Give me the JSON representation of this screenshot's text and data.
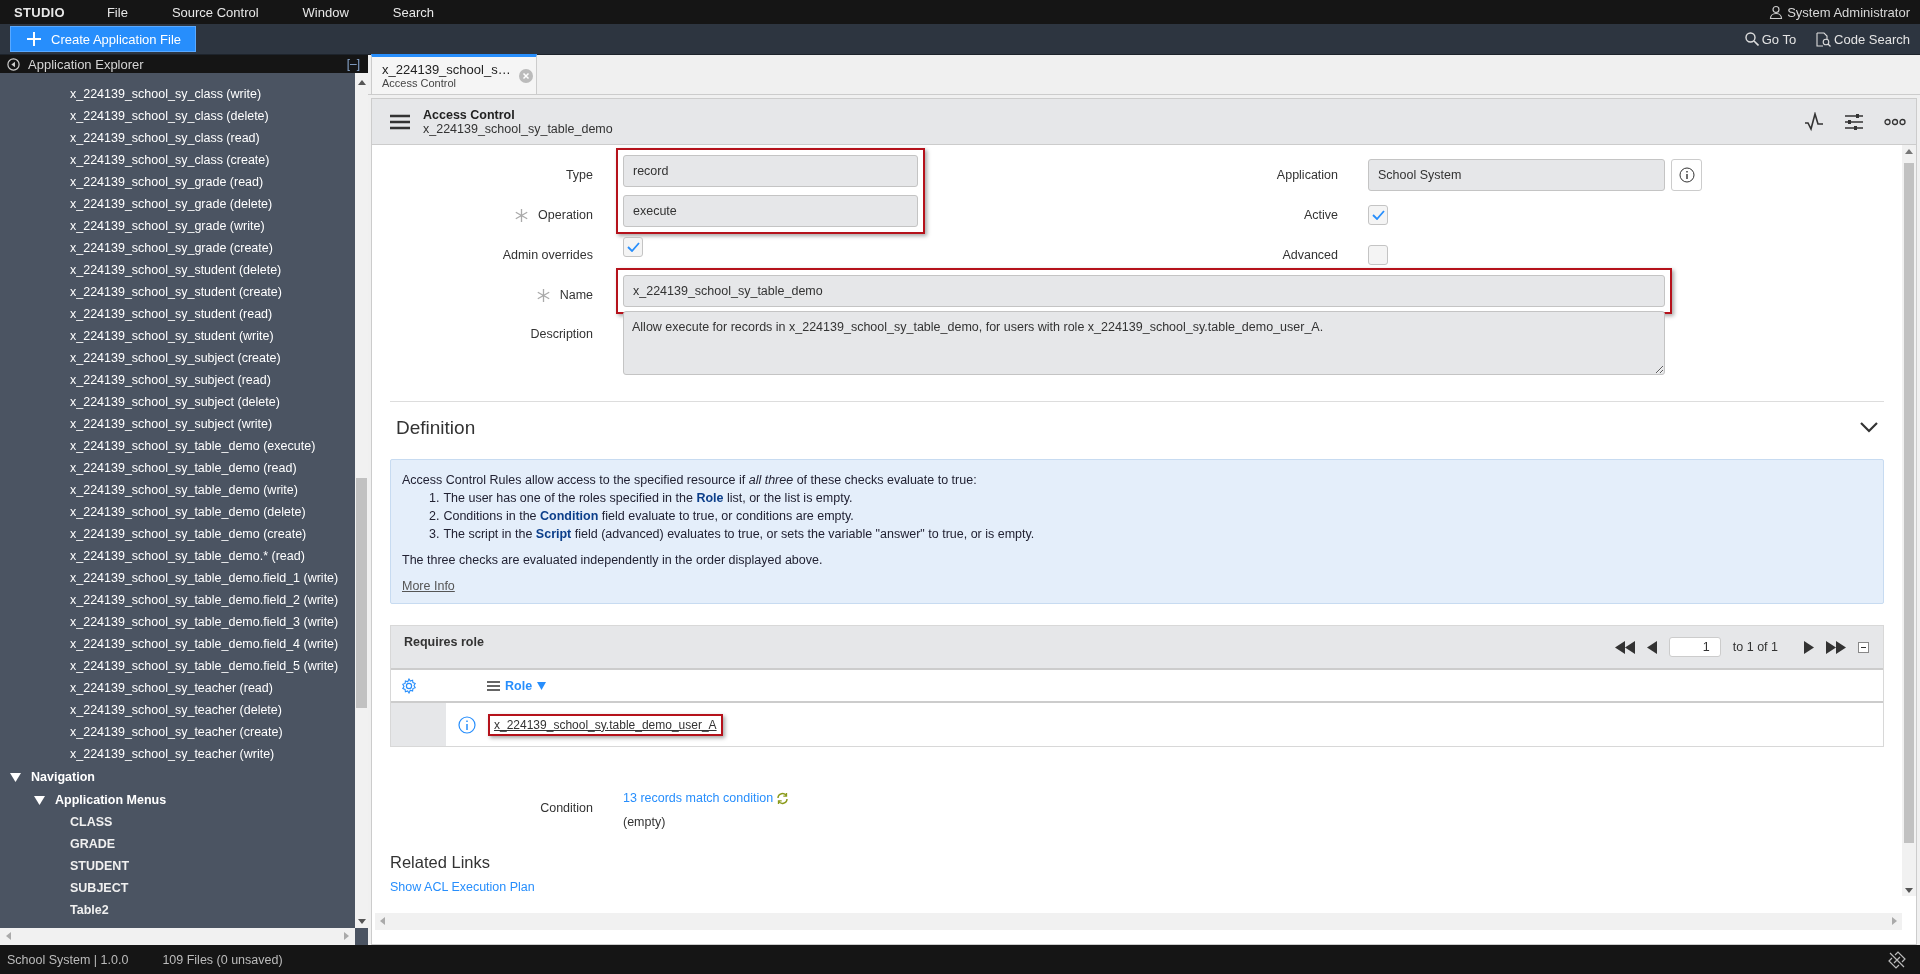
{
  "menubar": {
    "items": [
      "STUDIO",
      "File",
      "Source Control",
      "Window",
      "Search"
    ],
    "user": "System Administrator"
  },
  "toolbar": {
    "create_button": "Create Application File",
    "go_to": "Go To",
    "code_search": "Code Search"
  },
  "sidebar": {
    "title": "Application Explorer",
    "collapse": "[–]",
    "acl_items": [
      "x_224139_school_sy_class (write)",
      "x_224139_school_sy_class (delete)",
      "x_224139_school_sy_class (read)",
      "x_224139_school_sy_class (create)",
      "x_224139_school_sy_grade (read)",
      "x_224139_school_sy_grade (delete)",
      "x_224139_school_sy_grade (write)",
      "x_224139_school_sy_grade (create)",
      "x_224139_school_sy_student (delete)",
      "x_224139_school_sy_student (create)",
      "x_224139_school_sy_student (read)",
      "x_224139_school_sy_student (write)",
      "x_224139_school_sy_subject (create)",
      "x_224139_school_sy_subject (read)",
      "x_224139_school_sy_subject (delete)",
      "x_224139_school_sy_subject (write)",
      "x_224139_school_sy_table_demo (execute)",
      "x_224139_school_sy_table_demo (read)",
      "x_224139_school_sy_table_demo (write)",
      "x_224139_school_sy_table_demo (delete)",
      "x_224139_school_sy_table_demo (create)",
      "x_224139_school_sy_table_demo.* (read)",
      "x_224139_school_sy_table_demo.field_1 (write)",
      "x_224139_school_sy_table_demo.field_2 (write)",
      "x_224139_school_sy_table_demo.field_3 (write)",
      "x_224139_school_sy_table_demo.field_4 (write)",
      "x_224139_school_sy_table_demo.field_5 (write)",
      "x_224139_school_sy_teacher (read)",
      "x_224139_school_sy_teacher (delete)",
      "x_224139_school_sy_teacher (create)",
      "x_224139_school_sy_teacher (write)"
    ],
    "tree": [
      {
        "label": "Navigation",
        "expanded": true,
        "children": [
          {
            "label": "Application Menus",
            "expanded": true,
            "children": [
              {
                "label": "CLASS"
              },
              {
                "label": "GRADE"
              },
              {
                "label": "STUDENT"
              },
              {
                "label": "SUBJECT"
              },
              {
                "label": "Table2"
              }
            ]
          }
        ]
      }
    ]
  },
  "tabs": [
    {
      "title": "x_224139_school_s…",
      "subtitle": "Access Control",
      "selected": true
    }
  ],
  "form": {
    "header_title": "Access Control",
    "header_subtitle": "x_224139_school_sy_table_demo",
    "left_fields": [
      {
        "kind": "text",
        "label": "Type",
        "value": "record",
        "mandatory": false,
        "highlighted": true
      },
      {
        "kind": "text",
        "label": "Operation",
        "value": "execute",
        "mandatory": true,
        "highlighted": true
      },
      {
        "kind": "checkbox",
        "label": "Admin overrides",
        "checked": true,
        "mandatory": false,
        "highlighted": false
      }
    ],
    "right_fields": [
      {
        "kind": "reference",
        "label": "Application",
        "value": "School System",
        "mandatory": false,
        "highlighted": false
      },
      {
        "kind": "checkbox",
        "label": "Active",
        "checked": true,
        "mandatory": false,
        "highlighted": false
      },
      {
        "kind": "checkbox",
        "label": "Advanced",
        "checked": false,
        "mandatory": false,
        "highlighted": false
      }
    ],
    "wide_fields": [
      {
        "kind": "text",
        "label": "Name",
        "value": "x_224139_school_sy_table_demo",
        "mandatory": true,
        "highlighted": true
      },
      {
        "kind": "textarea",
        "label": "Description",
        "value": "Allow execute for records in x_224139_school_sy_table_demo, for users with role x_224139_school_sy.table_demo_user_A.",
        "mandatory": false,
        "highlighted": false
      }
    ]
  },
  "definition": {
    "title": "Definition",
    "expanded": true,
    "intro": "Access Control Rules allow access to the specified resource if *all three* of these checks evaluate to true:",
    "steps": [
      {
        "number": "1.",
        "text": "The user has one of the roles specified in the **Role** list, or the list is empty."
      },
      {
        "number": "2.",
        "text": "Conditions in the **Condition** field evaluate to true, or conditions are empty."
      },
      {
        "number": "3.",
        "text": "The script in the **Script** field (advanced) evaluates to true, or sets the variable \"answer\" to true, or is empty."
      }
    ],
    "note": "The three checks are evaluated independently in the order displayed above.",
    "more_info": "More Info"
  },
  "requires_role": {
    "title": "Requires role",
    "page": "1",
    "range": "to 1 of 1",
    "column": "Role",
    "rows": [
      {
        "role": "x_224139_school_sy.table_demo_user_A",
        "highlighted": true
      }
    ]
  },
  "condition": {
    "label": "Condition",
    "link": "13 records match condition",
    "value": "(empty)"
  },
  "related_links": {
    "title": "Related Links",
    "links": [
      "Show ACL Execution Plan"
    ]
  },
  "status_bar": {
    "app": "School System | 1.0.0",
    "files": "109 Files (0 unsaved)"
  }
}
